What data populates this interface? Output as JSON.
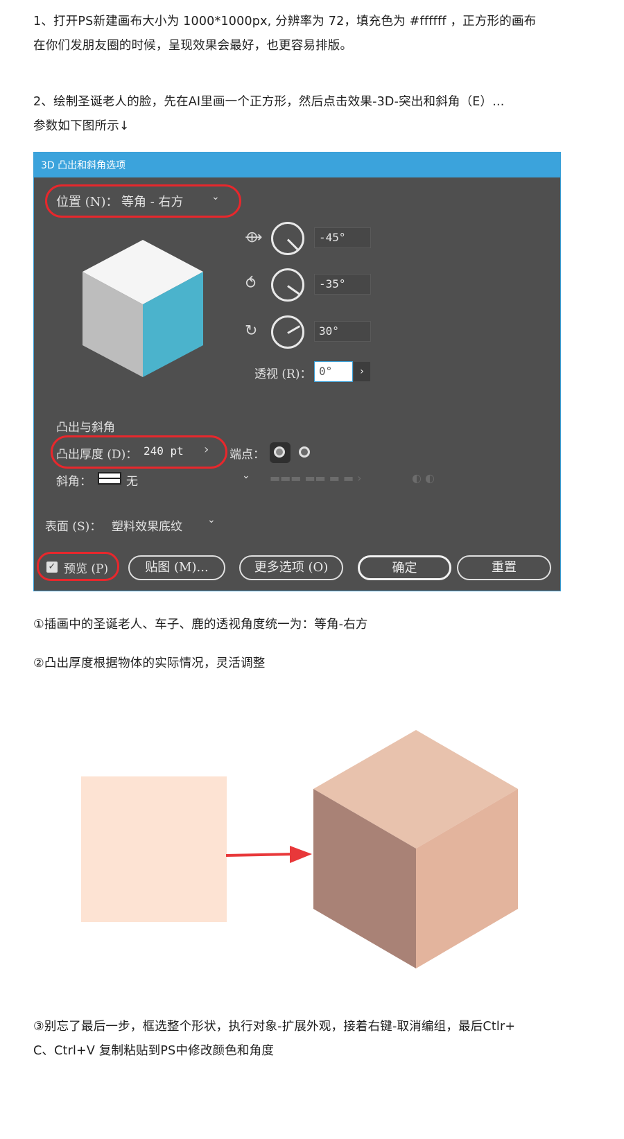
{
  "paragraphs": {
    "p1_line1": "1、打开PS新建画布大小为 1000*1000px, 分辨率为 72，填充色为 #ffffff ，正方形的画布",
    "p1_line2": "在你们发朋友圈的时候，呈现效果会最好，也更容易排版。",
    "p2_line1": "2、绘制圣诞老人的脸，先在AI里画一个正方形，然后点击效果-3D-突出和斜角（E）...",
    "p2_line2": "参数如下图所示↓",
    "note1": "①插画中的圣诞老人、车子、鹿的透视角度统一为：等角-右方",
    "note2": "②凸出厚度根据物体的实际情况，灵活调整",
    "note3_line1": "③别忘了最后一步，框选整个形状，执行对象-扩展外观，接着右键-取消编组，最后Ctlr+",
    "note3_line2": "C、Ctrl+V 复制粘贴到PS中修改颜色和角度"
  },
  "dialog": {
    "title": "3D 凸出和斜角选项",
    "position_label": "位置 (N)：",
    "position_value": "等角 - 右方",
    "rot_x": "-45°",
    "rot_y": "-35°",
    "rot_z": "30°",
    "perspective_label": "透视 (R)：",
    "perspective_value": "0°",
    "section_extrude": "凸出与斜角",
    "extrude_depth_label": "凸出厚度 (D)：",
    "extrude_depth_value": "240 pt",
    "cap_label": "端点：",
    "bevel_label": "斜角：",
    "bevel_value": "无",
    "surface_label": "表面 (S)：",
    "surface_value": "塑料效果底纹",
    "preview_label": "预览 (P)",
    "map_button": "贴图 (M)...",
    "more_options_button": "更多选项 (O)",
    "ok_button": "确定",
    "reset_button": "重置"
  },
  "colors": {
    "dialog_bg": "#4f4f4f",
    "title_bar": "#3ba3dc",
    "highlight_ring": "#e8272c",
    "cube_side": "#4bb3cc",
    "flat_square": "#fde3d3",
    "cube_top": "#e8c2ad",
    "cube_left": "#c99f8b",
    "cube_right": "#e6b8a1",
    "arrow": "#e8383a"
  },
  "icons": [
    "chevron-down-icon",
    "rotate-x-icon",
    "rotate-y-icon",
    "rotate-z-icon",
    "chevron-right-icon",
    "checkbox-icon",
    "cap-on-icon",
    "cap-off-icon",
    "arrow-right-icon"
  ]
}
